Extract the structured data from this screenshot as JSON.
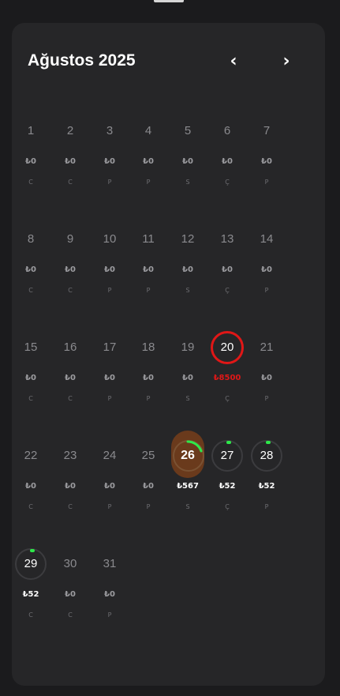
{
  "header": {
    "title": "Ağustos 2025",
    "prev_label": "‹",
    "next_label": "›"
  },
  "colors": {
    "accent_green": "#2ee84a",
    "today_red": "#e01717",
    "selected_brown": "#6a3a1c"
  },
  "days": [
    {
      "day": "1",
      "amount": "₺0",
      "weekday": "C"
    },
    {
      "day": "2",
      "amount": "₺0",
      "weekday": "C"
    },
    {
      "day": "3",
      "amount": "₺0",
      "weekday": "P"
    },
    {
      "day": "4",
      "amount": "₺0",
      "weekday": "P"
    },
    {
      "day": "5",
      "amount": "₺0",
      "weekday": "S"
    },
    {
      "day": "6",
      "amount": "₺0",
      "weekday": "Ç"
    },
    {
      "day": "7",
      "amount": "₺0",
      "weekday": "P"
    },
    {
      "day": "8",
      "amount": "₺0",
      "weekday": "C"
    },
    {
      "day": "9",
      "amount": "₺0",
      "weekday": "C"
    },
    {
      "day": "10",
      "amount": "₺0",
      "weekday": "P"
    },
    {
      "day": "11",
      "amount": "₺0",
      "weekday": "P"
    },
    {
      "day": "12",
      "amount": "₺0",
      "weekday": "S"
    },
    {
      "day": "13",
      "amount": "₺0",
      "weekday": "Ç"
    },
    {
      "day": "14",
      "amount": "₺0",
      "weekday": "P"
    },
    {
      "day": "15",
      "amount": "₺0",
      "weekday": "C"
    },
    {
      "day": "16",
      "amount": "₺0",
      "weekday": "C"
    },
    {
      "day": "17",
      "amount": "₺0",
      "weekday": "P"
    },
    {
      "day": "18",
      "amount": "₺0",
      "weekday": "P"
    },
    {
      "day": "19",
      "amount": "₺0",
      "weekday": "S"
    },
    {
      "day": "20",
      "amount": "₺8500",
      "weekday": "Ç",
      "today": true
    },
    {
      "day": "21",
      "amount": "₺0",
      "weekday": "P"
    },
    {
      "day": "22",
      "amount": "₺0",
      "weekday": "C"
    },
    {
      "day": "23",
      "amount": "₺0",
      "weekday": "C"
    },
    {
      "day": "24",
      "amount": "₺0",
      "weekday": "P"
    },
    {
      "day": "25",
      "amount": "₺0",
      "weekday": "P"
    },
    {
      "day": "26",
      "amount": "₺567",
      "weekday": "S",
      "selected": true,
      "progress": 0.2
    },
    {
      "day": "27",
      "amount": "₺52",
      "weekday": "Ç",
      "progress": 0.02
    },
    {
      "day": "28",
      "amount": "₺52",
      "weekday": "P",
      "progress": 0.02
    },
    {
      "day": "29",
      "amount": "₺52",
      "weekday": "C",
      "progress": 0.02
    },
    {
      "day": "30",
      "amount": "₺0",
      "weekday": "C"
    },
    {
      "day": "31",
      "amount": "₺0",
      "weekday": "P"
    }
  ]
}
